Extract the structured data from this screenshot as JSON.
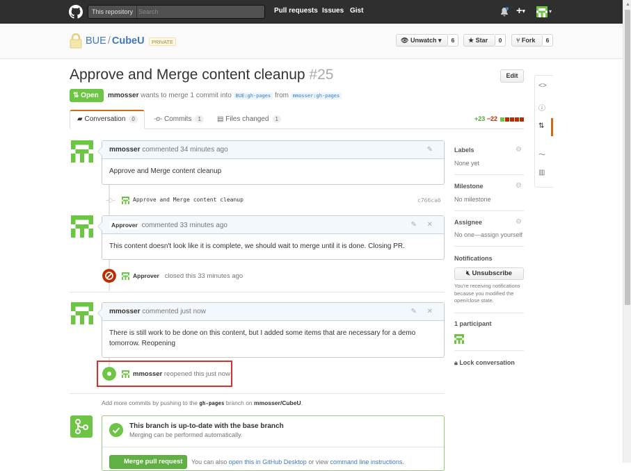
{
  "header": {
    "search_scope": "This repository",
    "search_placeholder": "Search",
    "nav": [
      "Pull requests",
      "Issues",
      "Gist"
    ],
    "plus_label": "+"
  },
  "repo": {
    "owner": "BUE",
    "separator": "/",
    "name": "CubeU",
    "visibility": "PRIVATE",
    "unwatch_label": "Unwatch",
    "watch_count": "6",
    "star_label": "Star",
    "star_count": "0",
    "fork_label": "Fork",
    "fork_count": "6"
  },
  "pr": {
    "title": "Approve and Merge content cleanup",
    "number": "#25",
    "edit_label": "Edit",
    "state": "Open",
    "author": "mmosser",
    "merge_text": "wants to merge 1 commit into",
    "base_branch": "BUE:gh-pages",
    "from_text": "from",
    "head_branch": "mmosser:gh-pages"
  },
  "tabs": [
    {
      "label": "Conversation",
      "count": "0"
    },
    {
      "label": "Commits",
      "count": "1"
    },
    {
      "label": "Files changed",
      "count": "1"
    }
  ],
  "diffstat": {
    "additions": "+23",
    "deletions": "−22"
  },
  "timeline": {
    "comment1": {
      "author": "mmosser",
      "action": "commented 34 minutes ago",
      "body": "Approve and Merge content cleanup"
    },
    "commit": {
      "message": "Approve and Merge content cleanup",
      "sha": "c766ca6"
    },
    "comment2": {
      "author": "Approver",
      "action": "commented 33 minutes ago",
      "body": "This content doesn't look like it is complete, we should wait to merge until it is done. Closing PR."
    },
    "closed_event": {
      "actor": "Approver",
      "text": "closed this 33 minutes ago"
    },
    "comment3": {
      "author": "mmosser",
      "action": "commented just now",
      "body": "There is still work to be done on this content, but I added some items that are necessary for a demo tomorrow. Reopening"
    },
    "reopened_event": {
      "actor": "mmosser",
      "text": "reopened this just now"
    },
    "push_hint": {
      "prefix": "Add more commits by pushing to the",
      "branch": "gh-pages",
      "middle": "branch on",
      "repo": "mmosser/CubeU",
      "suffix": "."
    }
  },
  "merge": {
    "title": "This branch is up-to-date with the base branch",
    "subtitle": "Merging can be performed automatically.",
    "button": "Merge pull request",
    "hint_prefix": "You can also",
    "hint_link1": "open this in GitHub Desktop",
    "hint_middle": "or view",
    "hint_link2": "command line instructions",
    "hint_suffix": "."
  },
  "sidebar": {
    "labels_title": "Labels",
    "labels_value": "None yet",
    "milestone_title": "Milestone",
    "milestone_value": "No milestone",
    "assignee_title": "Assignee",
    "assignee_value": "No one—assign yourself",
    "notifications_title": "Notifications",
    "unsubscribe_label": "Unsubscribe",
    "notifications_note": "You're receiving notifications because you modified the open/close state.",
    "participants_title": "1 participant",
    "lock_label": "Lock conversation"
  },
  "colors": {
    "header_bg": "#2f2f2f",
    "open_green": "#6cc644",
    "closed_red": "#bd2c00",
    "link_blue": "#4078c0",
    "highlight_red": "#d9302c",
    "tab_accent": "#d26911"
  }
}
